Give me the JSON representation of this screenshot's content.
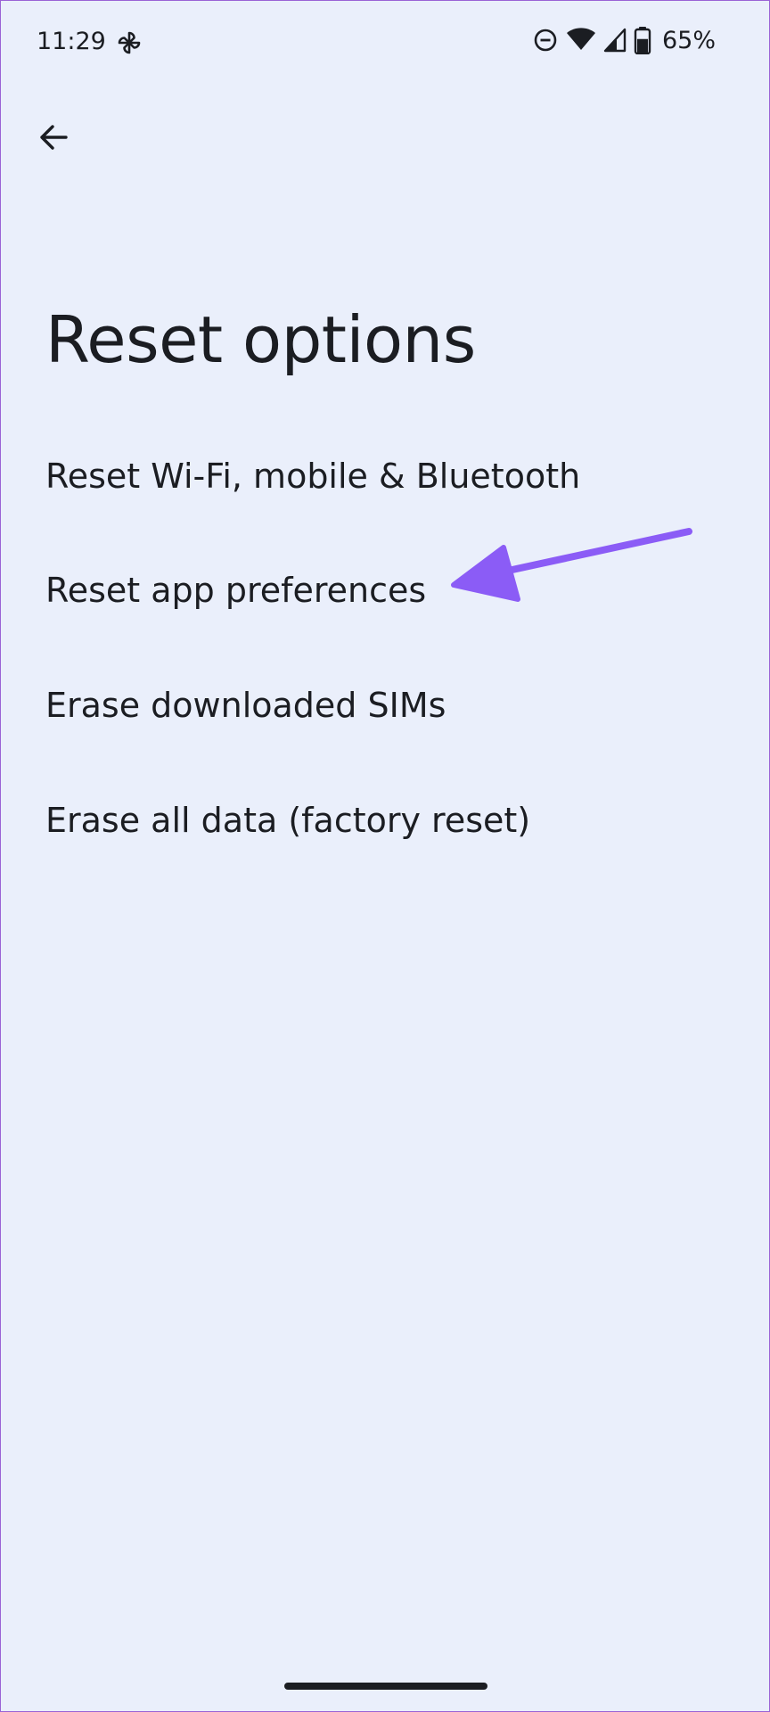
{
  "status_bar": {
    "time": "11:29",
    "battery_percent": "65%",
    "icons": [
      "pinwheel-icon",
      "do-not-disturb-icon",
      "wifi-icon",
      "cellular-signal-icon",
      "battery-icon"
    ],
    "battery_level": 0.65
  },
  "nav": {
    "back_icon": "arrow-left-icon"
  },
  "page": {
    "title": "Reset options"
  },
  "options": [
    {
      "label": "Reset Wi-Fi, mobile & Bluetooth"
    },
    {
      "label": "Reset app preferences"
    },
    {
      "label": "Erase downloaded SIMs"
    },
    {
      "label": "Erase all data (factory reset)"
    }
  ],
  "annotation": {
    "icon": "arrow-annotation-icon",
    "color": "#8b5cf6",
    "points_to": "Reset app preferences"
  },
  "colors": {
    "background": "#eaeffb",
    "text": "#1b1d22",
    "border": "#9a63d6"
  }
}
